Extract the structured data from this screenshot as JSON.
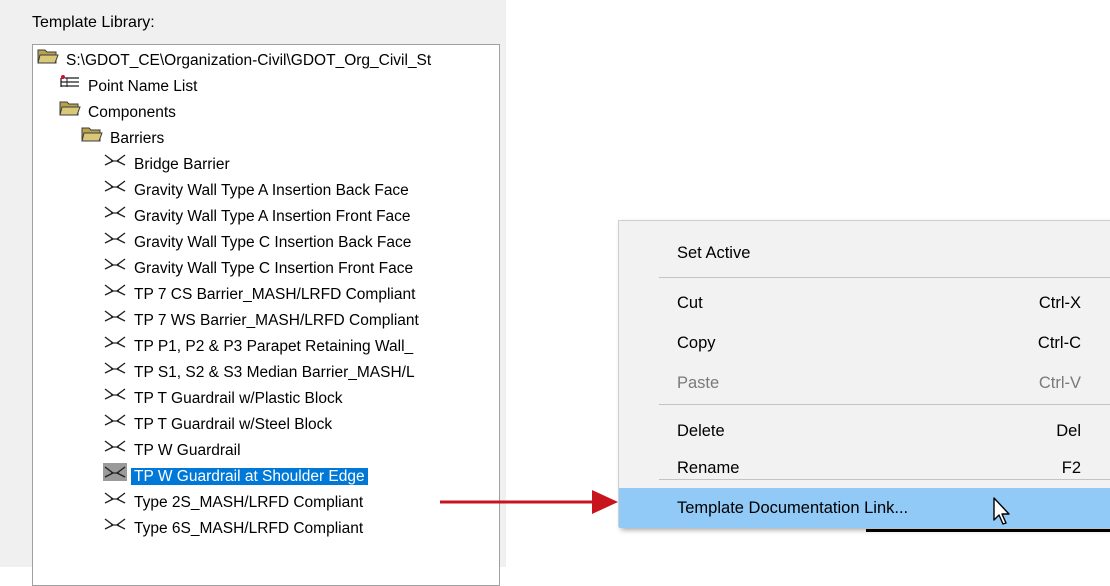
{
  "library": {
    "label": "Template Library:"
  },
  "tree": {
    "items": [
      {
        "label": "S:\\GDOT_CE\\Organization-Civil\\GDOT_Org_Civil_St",
        "icon": "folder-open-icon",
        "level": 0
      },
      {
        "label": "Point Name List",
        "icon": "point-list-icon",
        "level": 1
      },
      {
        "label": "Components",
        "icon": "folder-open-icon",
        "level": 1
      },
      {
        "label": "Barriers",
        "icon": "folder-open-icon",
        "level": 2
      },
      {
        "label": "Bridge Barrier",
        "icon": "template-icon",
        "level": 3
      },
      {
        "label": "Gravity Wall Type A Insertion Back Face",
        "icon": "template-icon",
        "level": 3
      },
      {
        "label": "Gravity Wall Type A Insertion Front Face",
        "icon": "template-icon",
        "level": 3
      },
      {
        "label": "Gravity Wall Type C Insertion Back Face",
        "icon": "template-icon",
        "level": 3
      },
      {
        "label": "Gravity Wall Type C Insertion Front Face",
        "icon": "template-icon",
        "level": 3
      },
      {
        "label": "TP 7 CS Barrier_MASH/LRFD Compliant",
        "icon": "template-icon",
        "level": 3
      },
      {
        "label": "TP 7 WS Barrier_MASH/LRFD Compliant",
        "icon": "template-icon",
        "level": 3
      },
      {
        "label": "TP P1, P2 & P3 Parapet Retaining Wall_",
        "icon": "template-icon",
        "level": 3
      },
      {
        "label": "TP S1, S2 & S3 Median Barrier_MASH/L",
        "icon": "template-icon",
        "level": 3
      },
      {
        "label": "TP T Guardrail w/Plastic Block",
        "icon": "template-icon",
        "level": 3
      },
      {
        "label": "TP T Guardrail w/Steel Block",
        "icon": "template-icon",
        "level": 3
      },
      {
        "label": "TP W Guardrail",
        "icon": "template-icon",
        "level": 3
      },
      {
        "label": "TP W Guardrail at Shoulder Edge",
        "icon": "template-icon",
        "level": 3,
        "selected": true
      },
      {
        "label": "Type 2S_MASH/LRFD Compliant",
        "icon": "template-icon",
        "level": 3
      },
      {
        "label": "Type 6S_MASH/LRFD Compliant",
        "icon": "template-icon",
        "level": 3
      }
    ]
  },
  "context_menu": {
    "items": [
      {
        "label": "Set Active",
        "shortcut": ""
      },
      {
        "label": "Cut",
        "shortcut": "Ctrl-X"
      },
      {
        "label": "Copy",
        "shortcut": "Ctrl-C"
      },
      {
        "label": "Paste",
        "shortcut": "Ctrl-V",
        "disabled": true
      },
      {
        "label": "Delete",
        "shortcut": "Del"
      },
      {
        "label": "Rename",
        "shortcut": "F2"
      },
      {
        "label": "Template Documentation Link...",
        "shortcut": "",
        "highlighted": true
      }
    ]
  },
  "colors": {
    "selection": "#0078d7",
    "menu_highlight": "#91c9f7",
    "arrow": "#c8141c",
    "folder": "#c8b45c"
  }
}
